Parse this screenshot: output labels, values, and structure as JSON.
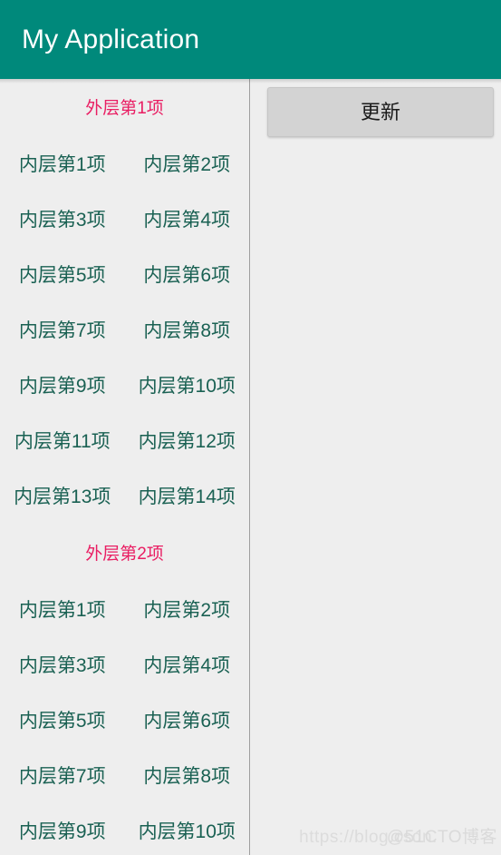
{
  "appbar": {
    "title": "My Application"
  },
  "right_panel": {
    "update_button_label": "更新"
  },
  "list": {
    "groups": [
      {
        "header": "外层第1项",
        "rows": [
          [
            "内层第1项",
            "内层第2项"
          ],
          [
            "内层第3项",
            "内层第4项"
          ],
          [
            "内层第5项",
            "内层第6项"
          ],
          [
            "内层第7项",
            "内层第8项"
          ],
          [
            "内层第9项",
            "内层第10项"
          ],
          [
            "内层第11项",
            "内层第12项"
          ],
          [
            "内层第13项",
            "内层第14项"
          ]
        ]
      },
      {
        "header": "外层第2项",
        "rows": [
          [
            "内层第1项",
            "内层第2项"
          ],
          [
            "内层第3项",
            "内层第4项"
          ],
          [
            "内层第5项",
            "内层第6项"
          ],
          [
            "内层第7项",
            "内层第8项"
          ],
          [
            "内层第9项",
            "内层第10项"
          ]
        ]
      }
    ]
  },
  "watermark": {
    "url": "https://blog.csdn.",
    "brand": "@51CTO博客"
  },
  "colors": {
    "appbar": "#00897B",
    "group_header": "#E91E63",
    "inner_item": "#1A6153",
    "background": "#EEEEEE",
    "button": "#D3D3D3"
  }
}
